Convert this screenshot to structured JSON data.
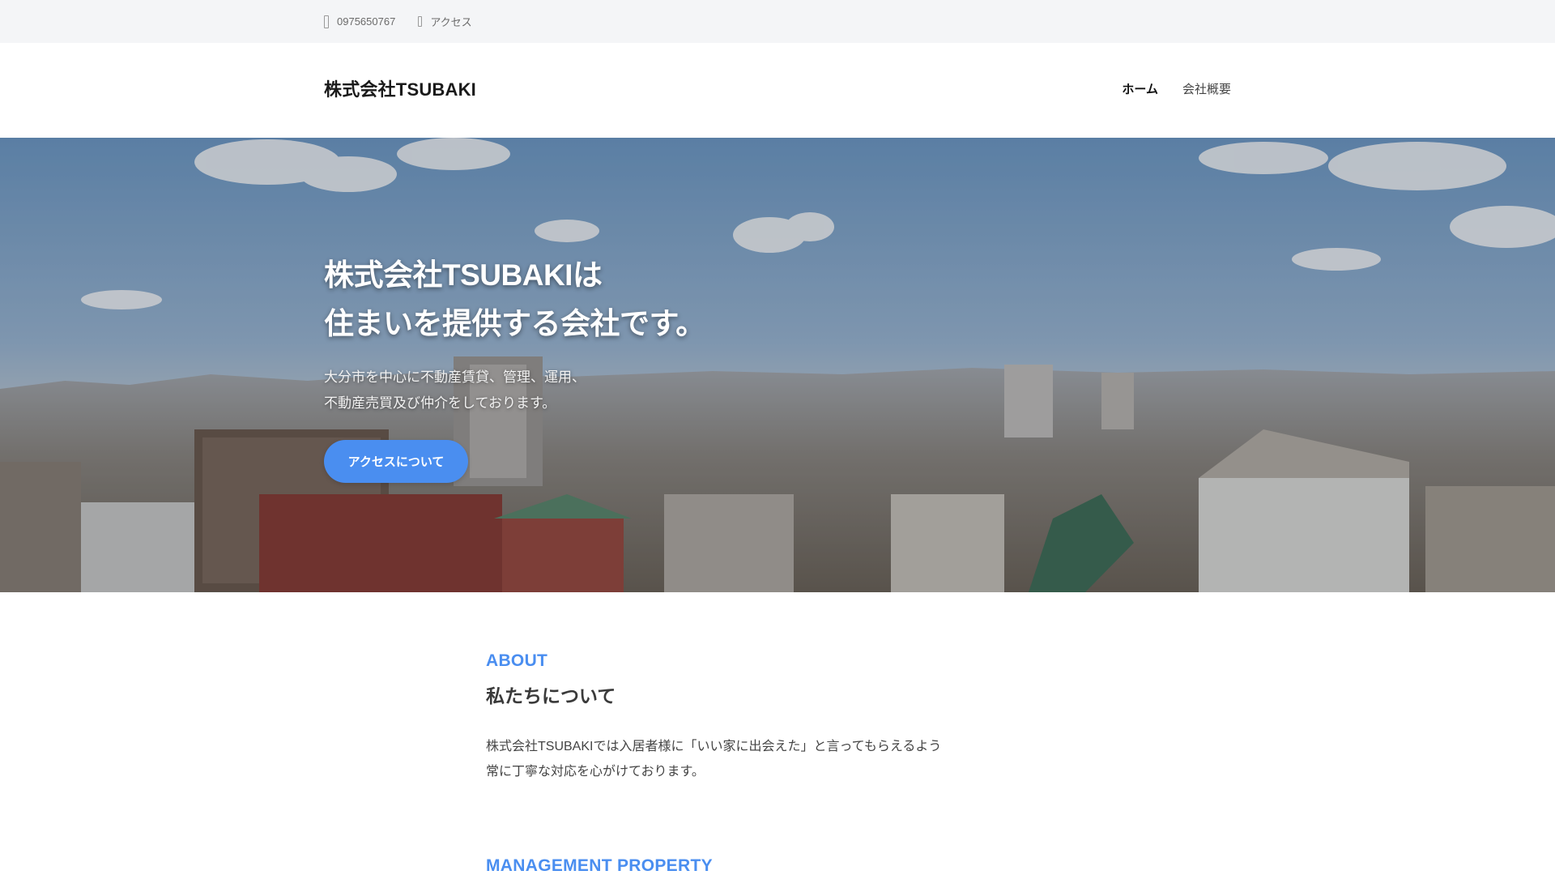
{
  "topbar": {
    "phone": "0975650767",
    "phone_icon": "phone-icon",
    "access": "アクセス",
    "access_icon": "map-pin-icon"
  },
  "header": {
    "logo": "株式会社TSUBAKI",
    "nav": [
      {
        "label": "ホーム",
        "active": true
      },
      {
        "label": "会社概要",
        "active": false
      }
    ]
  },
  "hero": {
    "title_line1": "株式会社TSUBAKIは",
    "title_line2": "住まいを提供する会社です。",
    "sub_line1": "大分市を中心に不動産賃貸、管理、運用、",
    "sub_line2": "不動産売買及び仲介をしております。",
    "button": "アクセスについて"
  },
  "about": {
    "label": "ABOUT",
    "title": "私たちについて",
    "body_line1": "株式会社TSUBAKIでは入居者様に「いい家に出会えた」と言ってもらえるよう",
    "body_line2": "常に丁寧な対応を心がけております。"
  },
  "management": {
    "label": "MANAGEMENT PROPERTY"
  },
  "colors": {
    "accent": "#4a8ef0",
    "topbar_bg": "#f4f5f7"
  }
}
